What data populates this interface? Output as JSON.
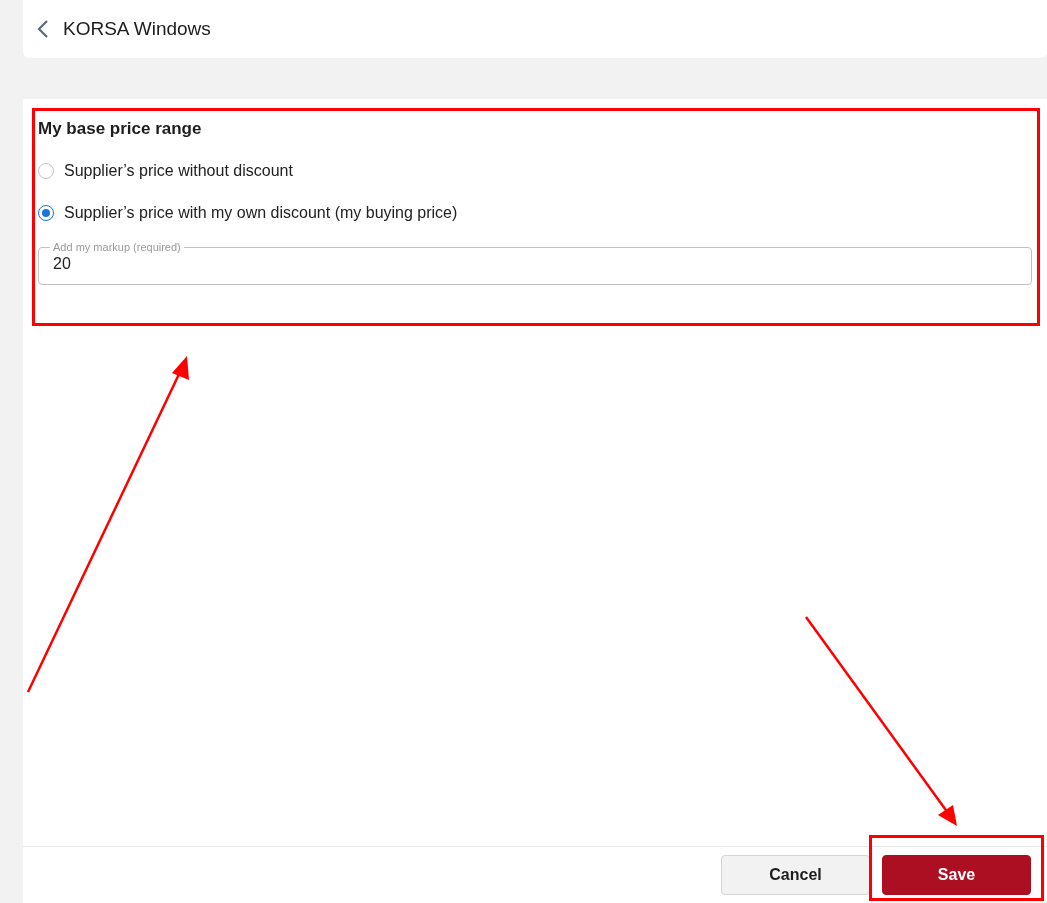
{
  "header": {
    "title": "KORSA Windows"
  },
  "section": {
    "title": "My base price range",
    "options": [
      {
        "label": "Supplier’s price without discount",
        "selected": false
      },
      {
        "label": "Supplier’s price with my own discount (my buying price)",
        "selected": true
      }
    ],
    "markup": {
      "label": "Add my markup (required)",
      "value": "20"
    }
  },
  "footer": {
    "buttons": [
      {
        "kind": "secondary",
        "label": "Cancel"
      },
      {
        "kind": "primary",
        "label": "Save"
      }
    ]
  }
}
